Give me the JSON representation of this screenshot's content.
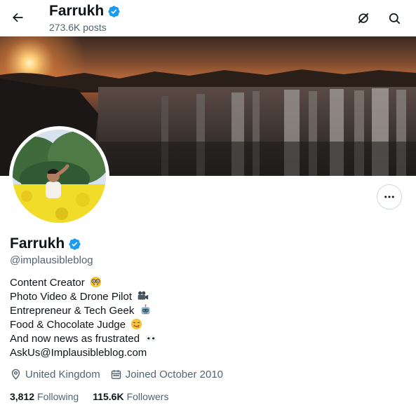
{
  "header": {
    "name": "Farrukh",
    "posts": "273.6K posts"
  },
  "profile": {
    "name": "Farrukh",
    "handle": "@implausibleblog",
    "bio": [
      {
        "text": "Content Creator",
        "emoji": "nerd-face"
      },
      {
        "text": "Photo Video & Drone Pilot",
        "emoji": "movie-camera"
      },
      {
        "text": "Entrepreneur & Tech Geek",
        "emoji": "robot"
      },
      {
        "text": "Food & Chocolate Judge",
        "emoji": "yum-face"
      },
      {
        "text": "And now news as frustrated",
        "emoji": "eyes"
      },
      {
        "text": "AskUs@Implausibleblog.com",
        "emoji": ""
      }
    ],
    "location": "United Kingdom",
    "joined": "Joined October 2010",
    "following_count": "3,812",
    "following_label": "Following",
    "followers_count": "115.6K",
    "followers_label": "Followers"
  },
  "icons": {
    "back": "arrow-left-icon",
    "grok": "grok-icon",
    "search": "search-icon",
    "more": "more-horizontal-icon",
    "location": "location-pin-icon",
    "calendar": "calendar-icon",
    "verified": "verified-badge-icon"
  },
  "colors": {
    "verified": "#1d9bf0",
    "secondary_text": "#536471",
    "primary_text": "#0f1419"
  }
}
